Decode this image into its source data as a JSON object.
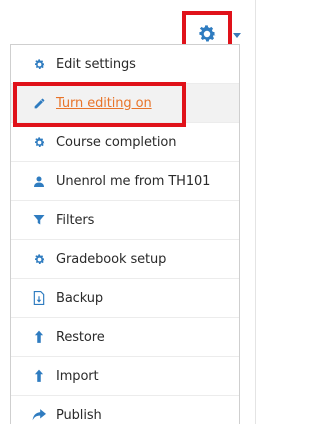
{
  "actions_menu": {
    "trigger_icon": "gear-icon",
    "items": [
      {
        "label": "Edit settings",
        "icon": "gear-icon"
      },
      {
        "label": "Turn editing on",
        "icon": "pencil-icon"
      },
      {
        "label": "Course completion",
        "icon": "gear-icon"
      },
      {
        "label": "Unenrol me from TH101",
        "icon": "user-icon"
      },
      {
        "label": "Filters",
        "icon": "filter-icon"
      },
      {
        "label": "Gradebook setup",
        "icon": "gear-icon"
      },
      {
        "label": "Backup",
        "icon": "file-icon"
      },
      {
        "label": "Restore",
        "icon": "upload-icon"
      },
      {
        "label": "Import",
        "icon": "upload-icon"
      },
      {
        "label": "Publish",
        "icon": "share-icon"
      }
    ]
  },
  "colors": {
    "icon_blue": "#2f7cc0",
    "link_orange": "#e8742a",
    "highlight_red": "#e0121a"
  }
}
